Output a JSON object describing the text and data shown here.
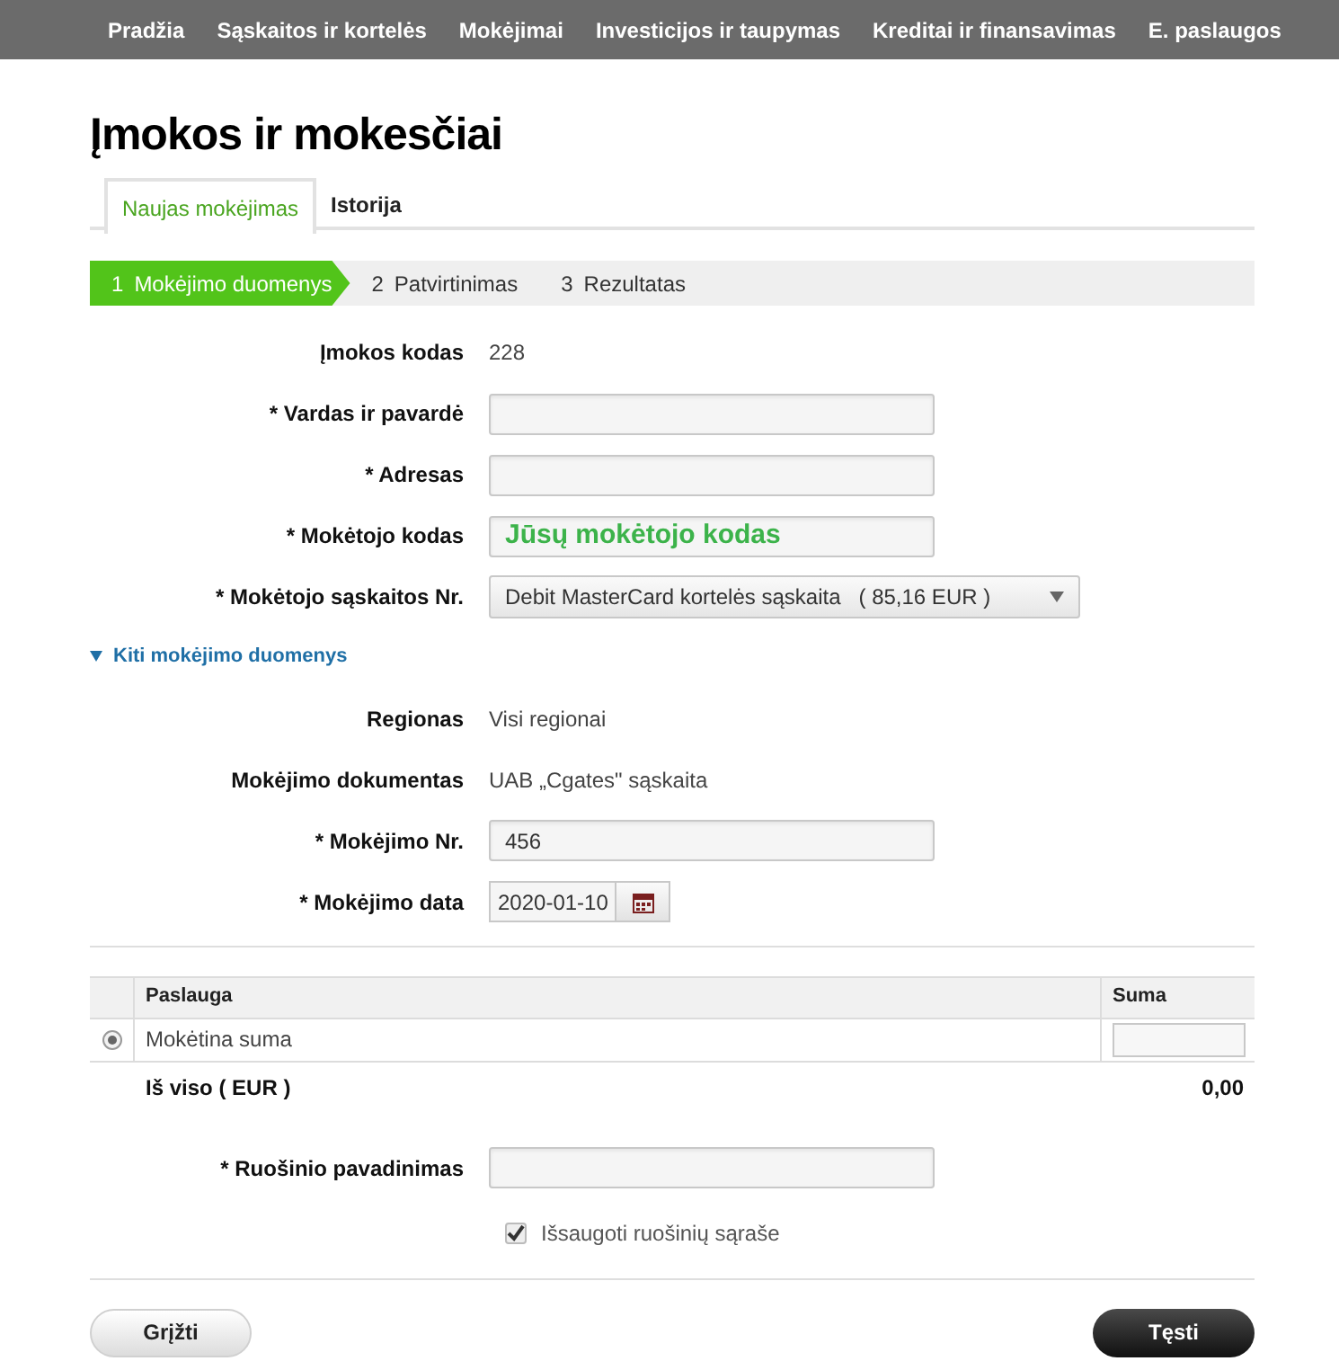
{
  "nav": [
    {
      "label": "Pradžia"
    },
    {
      "label": "Sąskaitos ir kortelės"
    },
    {
      "label": "Mokėjimai"
    },
    {
      "label": "Investicijos ir taupymas"
    },
    {
      "label": "Kreditai ir finansavimas"
    },
    {
      "label": "E. paslaugos"
    }
  ],
  "title": "Įmokos ir mokesčiai",
  "tabs": [
    {
      "label": "Naujas mokėjimas",
      "selected": true
    },
    {
      "label": "Istorija",
      "selected": false
    }
  ],
  "steps": [
    {
      "number": "1",
      "label": "Mokėjimo duomenys",
      "selected": true
    },
    {
      "number": "2",
      "label": "Patvirtinimas",
      "selected": false
    },
    {
      "number": "3",
      "label": "Rezultatas",
      "selected": false
    }
  ],
  "form": [
    {
      "kind": "text",
      "label": "Įmokos kodas",
      "value": "228"
    },
    {
      "kind": "input",
      "label": "* Vardas ir pavardė"
    },
    {
      "kind": "input",
      "label": "* Adresas"
    },
    {
      "kind": "input",
      "label": "* Mokėtojo kodas",
      "placeholder": "Jūsų mokėtojo kodas"
    },
    {
      "kind": "select",
      "label": "* Mokėtojo sąskaitos Nr.",
      "value": "Debit MasterCard kortelės sąskaita   ( 85,16 EUR )"
    }
  ],
  "more": {
    "label": "Kiti mokėjimo duomenys",
    "expanded": true,
    "fields": [
      {
        "kind": "text",
        "label": "Regionas",
        "value": "Visi regionai"
      },
      {
        "kind": "text",
        "label": "Mokėjimo dokumentas",
        "value": "UAB „Cgates\" sąskaita"
      },
      {
        "kind": "input",
        "label": "* Mokėjimo Nr.",
        "value": "456"
      },
      {
        "kind": "date",
        "label": "* Mokėjimo data",
        "value": "2020-01-10"
      }
    ]
  },
  "table": {
    "columns": [
      "Paslauga",
      "Suma"
    ],
    "rows": [
      {
        "service": "Mokėtina suma",
        "selected": true
      }
    ],
    "total_label": "Iš viso ( EUR )",
    "total": "0,00"
  },
  "draft": {
    "label": "* Ruošinio pavadinimas",
    "checkbox": {
      "label": "Išsaugoti ruošinių sąraše",
      "checked": true
    }
  },
  "buttons": {
    "back": "Grįžti",
    "next": "Tęsti"
  }
}
